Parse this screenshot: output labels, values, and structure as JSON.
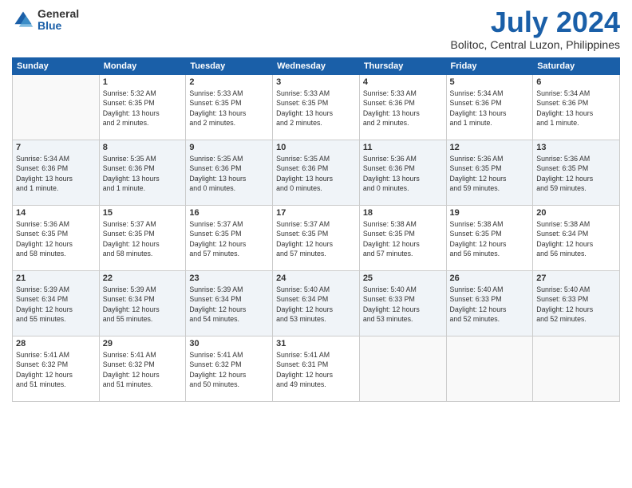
{
  "logo": {
    "general": "General",
    "blue": "Blue"
  },
  "title": "July 2024",
  "location": "Bolitoc, Central Luzon, Philippines",
  "days_header": [
    "Sunday",
    "Monday",
    "Tuesday",
    "Wednesday",
    "Thursday",
    "Friday",
    "Saturday"
  ],
  "weeks": [
    [
      {
        "day": "",
        "info": ""
      },
      {
        "day": "1",
        "info": "Sunrise: 5:32 AM\nSunset: 6:35 PM\nDaylight: 13 hours\nand 2 minutes."
      },
      {
        "day": "2",
        "info": "Sunrise: 5:33 AM\nSunset: 6:35 PM\nDaylight: 13 hours\nand 2 minutes."
      },
      {
        "day": "3",
        "info": "Sunrise: 5:33 AM\nSunset: 6:35 PM\nDaylight: 13 hours\nand 2 minutes."
      },
      {
        "day": "4",
        "info": "Sunrise: 5:33 AM\nSunset: 6:36 PM\nDaylight: 13 hours\nand 2 minutes."
      },
      {
        "day": "5",
        "info": "Sunrise: 5:34 AM\nSunset: 6:36 PM\nDaylight: 13 hours\nand 1 minute."
      },
      {
        "day": "6",
        "info": "Sunrise: 5:34 AM\nSunset: 6:36 PM\nDaylight: 13 hours\nand 1 minute."
      }
    ],
    [
      {
        "day": "7",
        "info": "Sunrise: 5:34 AM\nSunset: 6:36 PM\nDaylight: 13 hours\nand 1 minute."
      },
      {
        "day": "8",
        "info": "Sunrise: 5:35 AM\nSunset: 6:36 PM\nDaylight: 13 hours\nand 1 minute."
      },
      {
        "day": "9",
        "info": "Sunrise: 5:35 AM\nSunset: 6:36 PM\nDaylight: 13 hours\nand 0 minutes."
      },
      {
        "day": "10",
        "info": "Sunrise: 5:35 AM\nSunset: 6:36 PM\nDaylight: 13 hours\nand 0 minutes."
      },
      {
        "day": "11",
        "info": "Sunrise: 5:36 AM\nSunset: 6:36 PM\nDaylight: 13 hours\nand 0 minutes."
      },
      {
        "day": "12",
        "info": "Sunrise: 5:36 AM\nSunset: 6:35 PM\nDaylight: 12 hours\nand 59 minutes."
      },
      {
        "day": "13",
        "info": "Sunrise: 5:36 AM\nSunset: 6:35 PM\nDaylight: 12 hours\nand 59 minutes."
      }
    ],
    [
      {
        "day": "14",
        "info": "Sunrise: 5:36 AM\nSunset: 6:35 PM\nDaylight: 12 hours\nand 58 minutes."
      },
      {
        "day": "15",
        "info": "Sunrise: 5:37 AM\nSunset: 6:35 PM\nDaylight: 12 hours\nand 58 minutes."
      },
      {
        "day": "16",
        "info": "Sunrise: 5:37 AM\nSunset: 6:35 PM\nDaylight: 12 hours\nand 57 minutes."
      },
      {
        "day": "17",
        "info": "Sunrise: 5:37 AM\nSunset: 6:35 PM\nDaylight: 12 hours\nand 57 minutes."
      },
      {
        "day": "18",
        "info": "Sunrise: 5:38 AM\nSunset: 6:35 PM\nDaylight: 12 hours\nand 57 minutes."
      },
      {
        "day": "19",
        "info": "Sunrise: 5:38 AM\nSunset: 6:35 PM\nDaylight: 12 hours\nand 56 minutes."
      },
      {
        "day": "20",
        "info": "Sunrise: 5:38 AM\nSunset: 6:34 PM\nDaylight: 12 hours\nand 56 minutes."
      }
    ],
    [
      {
        "day": "21",
        "info": "Sunrise: 5:39 AM\nSunset: 6:34 PM\nDaylight: 12 hours\nand 55 minutes."
      },
      {
        "day": "22",
        "info": "Sunrise: 5:39 AM\nSunset: 6:34 PM\nDaylight: 12 hours\nand 55 minutes."
      },
      {
        "day": "23",
        "info": "Sunrise: 5:39 AM\nSunset: 6:34 PM\nDaylight: 12 hours\nand 54 minutes."
      },
      {
        "day": "24",
        "info": "Sunrise: 5:40 AM\nSunset: 6:34 PM\nDaylight: 12 hours\nand 53 minutes."
      },
      {
        "day": "25",
        "info": "Sunrise: 5:40 AM\nSunset: 6:33 PM\nDaylight: 12 hours\nand 53 minutes."
      },
      {
        "day": "26",
        "info": "Sunrise: 5:40 AM\nSunset: 6:33 PM\nDaylight: 12 hours\nand 52 minutes."
      },
      {
        "day": "27",
        "info": "Sunrise: 5:40 AM\nSunset: 6:33 PM\nDaylight: 12 hours\nand 52 minutes."
      }
    ],
    [
      {
        "day": "28",
        "info": "Sunrise: 5:41 AM\nSunset: 6:32 PM\nDaylight: 12 hours\nand 51 minutes."
      },
      {
        "day": "29",
        "info": "Sunrise: 5:41 AM\nSunset: 6:32 PM\nDaylight: 12 hours\nand 51 minutes."
      },
      {
        "day": "30",
        "info": "Sunrise: 5:41 AM\nSunset: 6:32 PM\nDaylight: 12 hours\nand 50 minutes."
      },
      {
        "day": "31",
        "info": "Sunrise: 5:41 AM\nSunset: 6:31 PM\nDaylight: 12 hours\nand 49 minutes."
      },
      {
        "day": "",
        "info": ""
      },
      {
        "day": "",
        "info": ""
      },
      {
        "day": "",
        "info": ""
      }
    ]
  ]
}
